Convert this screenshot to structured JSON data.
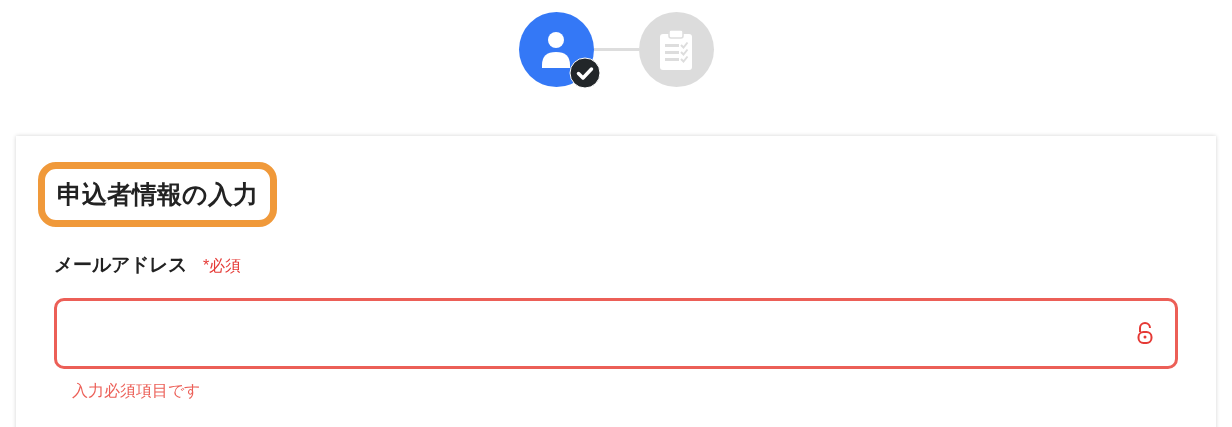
{
  "steps": [
    {
      "kind": "person",
      "selected": true,
      "completed": true
    },
    {
      "kind": "clipboard",
      "selected": false,
      "completed": false
    }
  ],
  "form": {
    "heading": "申込者情報の入力",
    "heading_highlighted": true,
    "fields": [
      {
        "label": "メールアドレス",
        "required_mark": "*必須",
        "error": true,
        "error_message": "入力必須項目です"
      }
    ]
  }
}
